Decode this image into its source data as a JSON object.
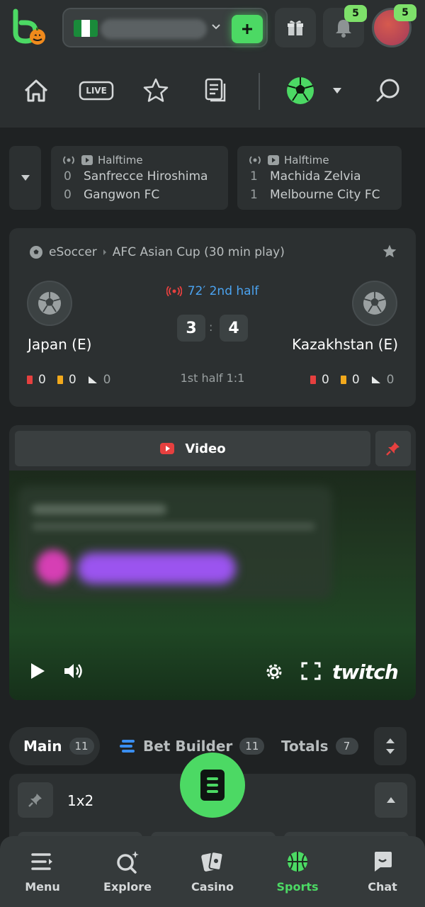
{
  "header": {
    "wallet": {
      "currency_flag": "nigeria-flag",
      "deposit_icon": "plus-icon"
    },
    "gift_icon": "gift-icon",
    "notifications": {
      "icon": "bell-icon",
      "count": "5"
    },
    "profile": {
      "count": "5"
    }
  },
  "nav": {
    "items": [
      "home-icon",
      "live-icon",
      "star-icon",
      "betslip-list-icon",
      "soccer-ball-icon",
      "search-icon"
    ],
    "live_label": "LIVE"
  },
  "live_strip": [
    {
      "status": "Halftime",
      "team1": "Sanfrecce Hiroshima",
      "score1": "0",
      "team2": "Gangwon FC",
      "score2": "0"
    },
    {
      "status": "Halftime",
      "team1": "Machida Zelvia",
      "score1": "1",
      "team2": "Melbourne City FC",
      "score2": "1"
    }
  ],
  "match": {
    "sport": "eSoccer",
    "league": "AFC Asian Cup (30 min play)",
    "clock": "72′ 2nd half",
    "home": {
      "name": "Japan (E)",
      "score": "3",
      "red": "0",
      "yellow": "0",
      "corners": "0"
    },
    "away": {
      "name": "Kazakhstan (E)",
      "score": "4",
      "red": "0",
      "yellow": "0",
      "corners": "0"
    },
    "half_score": "1st half 1:1",
    "colon": ":"
  },
  "video": {
    "label": "Video",
    "provider": "twitch"
  },
  "market_tabs": [
    {
      "label": "Main",
      "count": "11"
    },
    {
      "label": "Bet Builder",
      "count": "11"
    },
    {
      "label": "Totals",
      "count": "7"
    }
  ],
  "market": {
    "title": "1x2"
  },
  "bottom_nav": [
    {
      "label": "Menu",
      "icon": "menu-icon"
    },
    {
      "label": "Explore",
      "icon": "explore-search-icon"
    },
    {
      "label": "Casino",
      "icon": "cards-icon"
    },
    {
      "label": "Sports",
      "icon": "basketball-icon"
    },
    {
      "label": "Chat",
      "icon": "chat-icon"
    }
  ],
  "colors": {
    "accent": "#4cd964",
    "live_red": "#e6403f",
    "clock_blue": "#4ba3f0",
    "background": "#1f2223"
  }
}
